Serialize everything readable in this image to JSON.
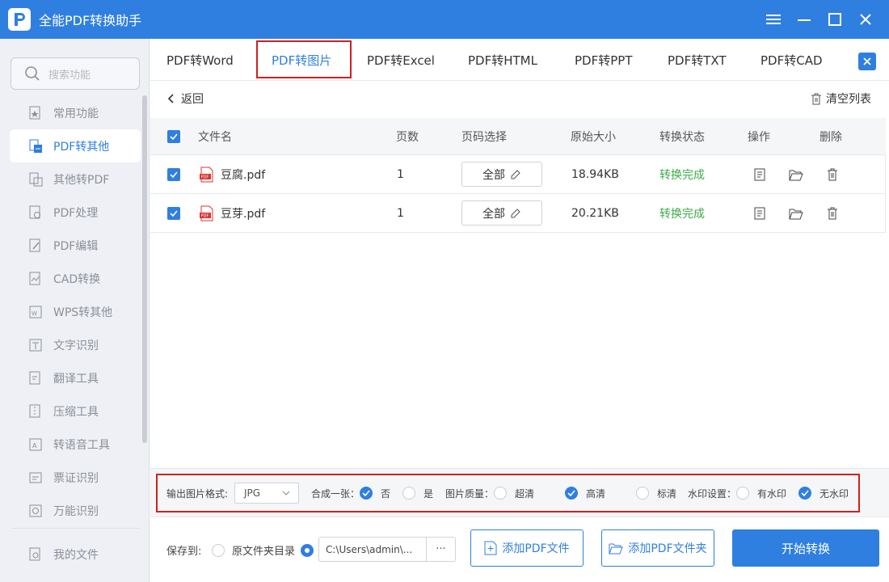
{
  "app": {
    "title": "全能PDF转换助手"
  },
  "sidebar": {
    "search_placeholder": "搜索功能",
    "items": [
      {
        "label": "常用功能",
        "icon": "star-doc-icon",
        "active": false
      },
      {
        "label": "PDF转其他",
        "icon": "pdf-convert-icon",
        "active": true
      },
      {
        "label": "其他转PDF",
        "icon": "to-pdf-icon",
        "active": false
      },
      {
        "label": "PDF处理",
        "icon": "pdf-process-icon",
        "active": false
      },
      {
        "label": "PDF编辑",
        "icon": "pdf-edit-icon",
        "active": false
      },
      {
        "label": "CAD转换",
        "icon": "cad-icon",
        "active": false
      },
      {
        "label": "WPS转其他",
        "icon": "wps-icon",
        "active": false
      },
      {
        "label": "文字识别",
        "icon": "text-ocr-icon",
        "active": false
      },
      {
        "label": "翻译工具",
        "icon": "translate-icon",
        "active": false
      },
      {
        "label": "压缩工具",
        "icon": "compress-icon",
        "active": false
      },
      {
        "label": "转语音工具",
        "icon": "speech-icon",
        "active": false
      },
      {
        "label": "票证识别",
        "icon": "ticket-icon",
        "active": false
      },
      {
        "label": "万能识别",
        "icon": "universal-ocr-icon",
        "active": false
      }
    ],
    "bottom_item": {
      "label": "我的文件",
      "icon": "my-files-icon"
    }
  },
  "tabs": [
    {
      "label": "PDF转Word",
      "active": false
    },
    {
      "label": "PDF转图片",
      "active": true
    },
    {
      "label": "PDF转Excel",
      "active": false
    },
    {
      "label": "PDF转HTML",
      "active": false
    },
    {
      "label": "PDF转PPT",
      "active": false
    },
    {
      "label": "PDF转TXT",
      "active": false
    },
    {
      "label": "PDF转CAD",
      "active": false
    }
  ],
  "toolbar": {
    "back_label": "返回",
    "clear_label": "清空列表"
  },
  "table": {
    "headers": {
      "filename": "文件名",
      "pages": "页数",
      "page_select": "页码选择",
      "size": "原始大小",
      "status": "转换状态",
      "actions": "操作",
      "delete": "删除"
    },
    "rows": [
      {
        "name": "豆腐.pdf",
        "pages": "1",
        "page_select": "全部",
        "size": "18.94KB",
        "status": "转换完成",
        "checked": true
      },
      {
        "name": "豆芽.pdf",
        "pages": "1",
        "page_select": "全部",
        "size": "20.21KB",
        "status": "转换完成",
        "checked": true
      }
    ]
  },
  "options": {
    "format_label": "输出图片格式:",
    "format_value": "JPG",
    "merge_label": "合成一张：",
    "merge_no": "否",
    "merge_yes": "是",
    "merge_selected": "否",
    "quality_label": "图片质量：",
    "quality_ultra": "超清",
    "quality_high": "高清",
    "quality_standard": "标清",
    "quality_selected": "高清",
    "watermark_label": "水印设置：",
    "watermark_yes": "有水印",
    "watermark_no": "无水印",
    "watermark_selected": "无水印"
  },
  "footer": {
    "save_label": "保存到:",
    "original_dir_label": "原文件夹目录",
    "path_value": "C:\\Users\\admin\\...",
    "more_label": "···",
    "add_file_label": "添加PDF文件",
    "add_folder_label": "添加PDF文件夹",
    "start_label": "开始转换"
  },
  "colors": {
    "accent": "#2f7fe0",
    "success": "#3cab47",
    "highlight": "#d0201f"
  }
}
